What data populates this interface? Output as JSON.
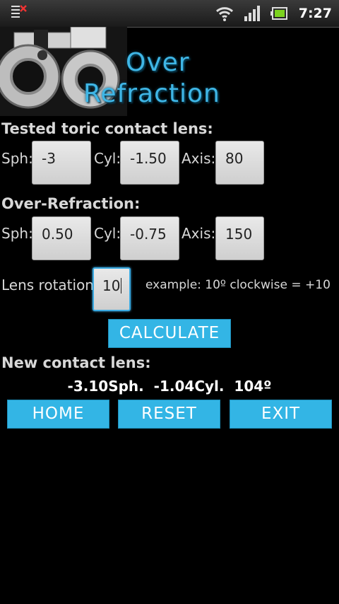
{
  "status_bar": {
    "time": "7:27",
    "icons": [
      "notification-icon",
      "wifi-icon",
      "signal-icon",
      "battery-icon"
    ]
  },
  "header": {
    "title_line1": "Over",
    "title_line2": "Refraction"
  },
  "tested_lens": {
    "title": "Tested toric contact lens:",
    "sph_label": "Sph:",
    "sph_value": "-3",
    "cyl_label": "Cyl:",
    "cyl_value": "-1.50",
    "axis_label": "Axis:",
    "axis_value": "80"
  },
  "over_refraction": {
    "title": "Over-Refraction:",
    "sph_label": "Sph:",
    "sph_value": "0.50",
    "cyl_label": "Cyl:",
    "cyl_value": "-0.75",
    "axis_label": "Axis:",
    "axis_value": "150"
  },
  "rotation": {
    "label": "Lens rotation:",
    "value": "10",
    "example": "example: 10º clockwise = +10"
  },
  "calculate_label": "CALCULATE",
  "new_lens": {
    "title": "New contact lens:",
    "result": "-3.10Sph.  -1.04Cyl.  104º"
  },
  "buttons": {
    "home": "HOME",
    "reset": "RESET",
    "exit": "EXIT"
  },
  "colors": {
    "accent": "#33b5e5",
    "background": "#000000"
  }
}
